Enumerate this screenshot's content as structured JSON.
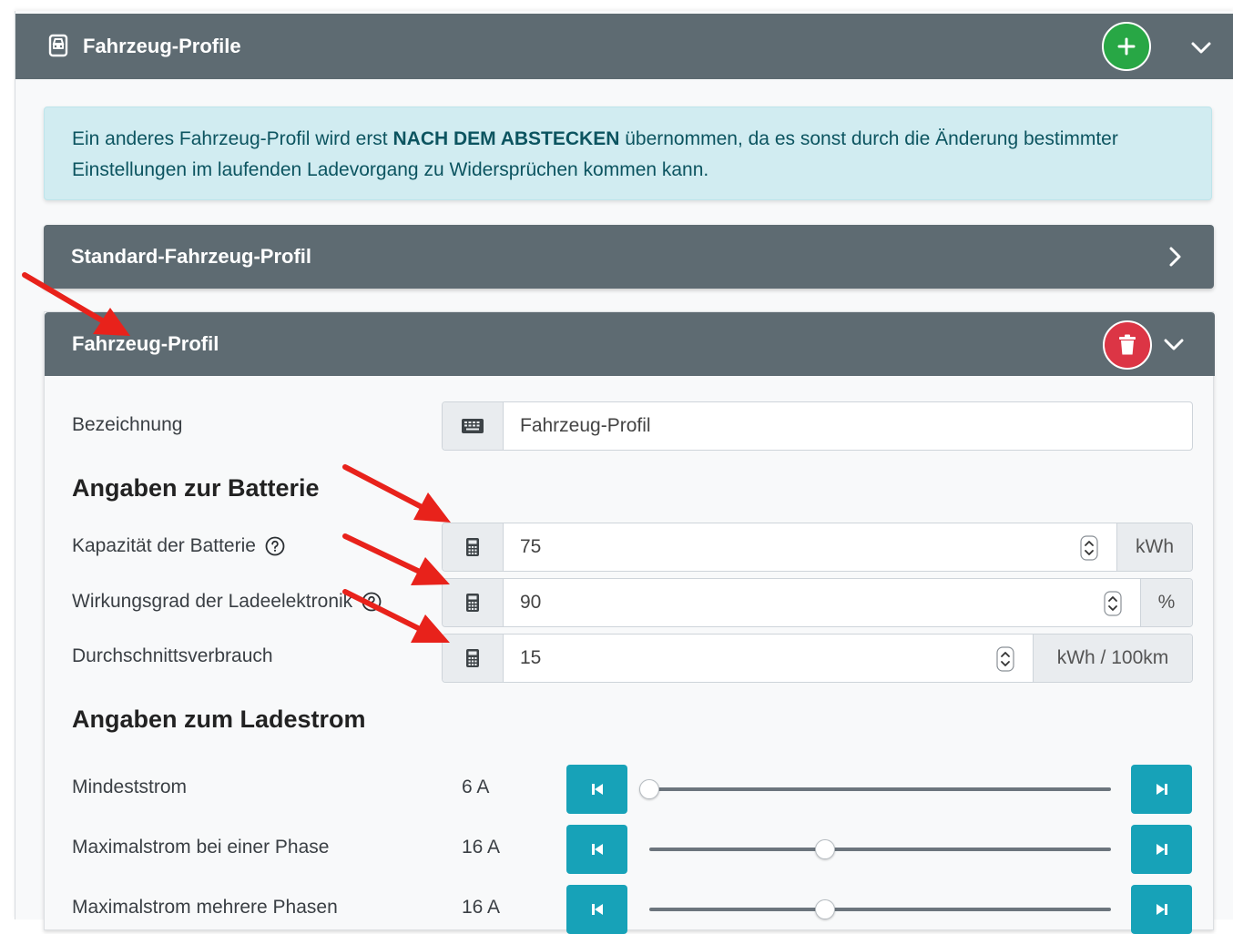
{
  "header": {
    "title": "Fahrzeug-Profile",
    "add_icon": "plus-icon",
    "collapse_icon": "chevron-down-icon"
  },
  "alert": {
    "text_before": "Ein anderes Fahrzeug-Profil wird erst ",
    "text_bold": "NACH DEM ABSTECKEN",
    "text_after": " übernommen, da es sonst durch die Änderung bestimmter Einstellungen im laufenden Ladevorgang zu Widersprüchen kommen kann."
  },
  "standard_profile": {
    "title": "Standard-Fahrzeug-Profil",
    "expand_icon": "chevron-right-icon"
  },
  "profile": {
    "title": "Fahrzeug-Profil",
    "name_label": "Bezeichnung",
    "name_value": "Fahrzeug-Profil",
    "battery_section": "Angaben zur Batterie",
    "capacity_label": "Kapazität der Batterie",
    "capacity_value": "75",
    "capacity_unit": "kWh",
    "efficiency_label": "Wirkungsgrad der Ladeelektronik",
    "efficiency_value": "90",
    "efficiency_unit": "%",
    "consumption_label": "Durchschnittsverbrauch",
    "consumption_value": "15",
    "consumption_unit": "kWh / 100km",
    "current_section": "Angaben zum Ladestrom",
    "sliders": [
      {
        "label": "Mindeststrom",
        "value": "6 A",
        "level": 0.0
      },
      {
        "label": "Maximalstrom bei einer Phase",
        "value": "16 A",
        "level": 0.38
      },
      {
        "label": "Maximalstrom mehrere Phasen",
        "value": "16 A",
        "level": 0.38
      }
    ]
  },
  "colors": {
    "header_bar": "#5e6b72",
    "add_button": "#28a745",
    "delete_button": "#dc3545",
    "alert_bg": "#d1ecf1",
    "step_button": "#17a2b8",
    "annotation_arrow": "#e8221b"
  }
}
